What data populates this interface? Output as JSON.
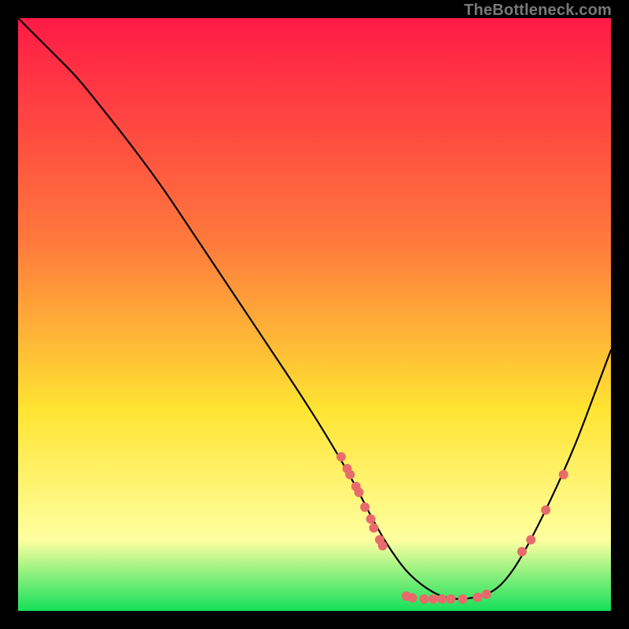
{
  "watermark": "TheBottleneck.com",
  "colors": {
    "black": "#000000",
    "curve": "#000000",
    "dot": "#e86b6b",
    "grad_top": "#ff1a46",
    "grad_mid1": "#ff7a3c",
    "grad_mid2": "#ffe432",
    "grad_low": "#ffffa0",
    "grad_bottom": "#14e05a"
  },
  "chart_data": {
    "type": "line",
    "title": "",
    "xlabel": "",
    "ylabel": "",
    "xlim": [
      0,
      100
    ],
    "ylim": [
      0,
      100
    ],
    "series": [
      {
        "name": "bottleneck-curve",
        "x": [
          0,
          3,
          6,
          10,
          14,
          18,
          24,
          30,
          36,
          42,
          48,
          53,
          57,
          60,
          63,
          66,
          70,
          73,
          76,
          80,
          83,
          86,
          90,
          94,
          97,
          100
        ],
        "y": [
          100,
          97,
          94,
          90,
          85,
          80,
          72,
          63,
          54,
          45,
          36,
          28,
          21,
          15,
          10,
          6,
          3,
          2,
          2,
          3,
          6,
          11,
          19,
          28,
          36,
          44
        ]
      }
    ],
    "dots": {
      "name": "highlighted-points",
      "points": [
        {
          "x": 54.5,
          "y": 26.0
        },
        {
          "x": 55.5,
          "y": 24.0
        },
        {
          "x": 56.0,
          "y": 23.0
        },
        {
          "x": 57.0,
          "y": 21.0
        },
        {
          "x": 57.5,
          "y": 20.0
        },
        {
          "x": 58.5,
          "y": 17.5
        },
        {
          "x": 59.5,
          "y": 15.5
        },
        {
          "x": 60.0,
          "y": 14.0
        },
        {
          "x": 61.0,
          "y": 12.0
        },
        {
          "x": 61.5,
          "y": 11.0
        },
        {
          "x": 65.5,
          "y": 2.5
        },
        {
          "x": 66.5,
          "y": 2.2
        },
        {
          "x": 68.5,
          "y": 2.0
        },
        {
          "x": 70.0,
          "y": 2.0
        },
        {
          "x": 71.5,
          "y": 2.0
        },
        {
          "x": 73.0,
          "y": 2.0
        },
        {
          "x": 75.0,
          "y": 2.0
        },
        {
          "x": 77.5,
          "y": 2.3
        },
        {
          "x": 79.0,
          "y": 2.8
        },
        {
          "x": 85.0,
          "y": 10.0
        },
        {
          "x": 86.5,
          "y": 12.0
        },
        {
          "x": 89.0,
          "y": 17.0
        },
        {
          "x": 92.0,
          "y": 23.0
        }
      ]
    }
  }
}
